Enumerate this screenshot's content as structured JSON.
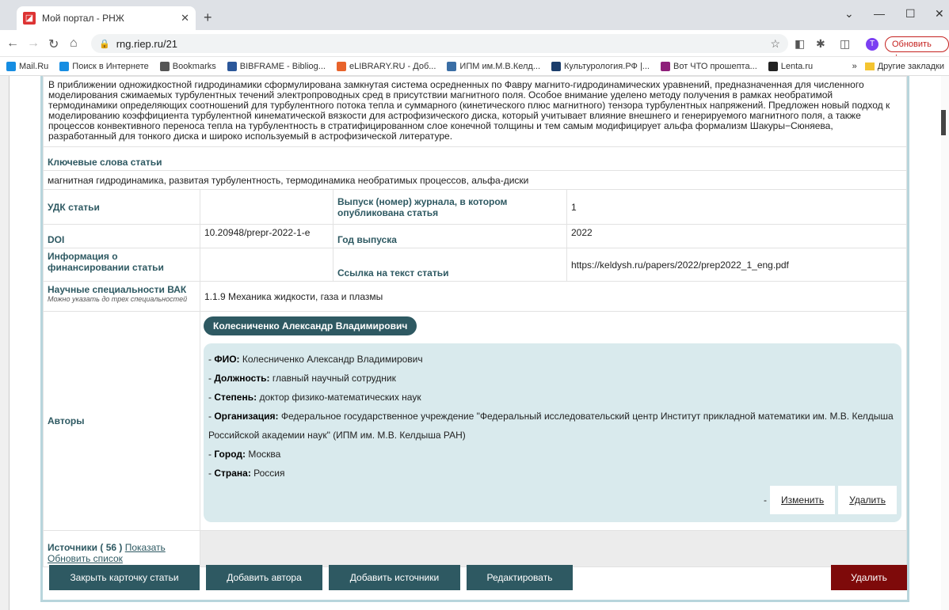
{
  "browser": {
    "tab_title": "Мой портал - РНЖ",
    "url": "rng.riep.ru/21",
    "update_label": "Обновить",
    "avatar_letter": "T",
    "bookmarks": [
      {
        "label": "Mail.Ru",
        "color": "#168de2"
      },
      {
        "label": "Поиск в Интернете",
        "color": "#168de2"
      },
      {
        "label": "Bookmarks",
        "color": "#555555"
      },
      {
        "label": "BIBFRAME - Bibliog...",
        "color": "#2b579a"
      },
      {
        "label": "eLIBRARY.RU - Доб...",
        "color": "#e8632b"
      },
      {
        "label": "ИПМ им.М.В.Келд...",
        "color": "#3a6ea5"
      },
      {
        "label": "Культурология.РФ |...",
        "color": "#1a3d6b"
      },
      {
        "label": "Вот ЧТО прошепта...",
        "color": "#8e1f7a"
      },
      {
        "label": "Lenta.ru",
        "color": "#222222"
      }
    ],
    "other_bookmarks": "Другие закладки"
  },
  "article": {
    "abstract": "В приближении одножидкостной гидродинамики сформулирована замкнутая система осредненных по Фавру магнито-гидродинамических уравнений, предназначенная для численного моделирования сжимаемых турбулентных течений электропроводных сред в присутствии магнитного поля. Особое внимание уделено методу получения в рамках необратимой термодинамики определяющих соотношений для турбулентного потока тепла и суммарного (кинетического плюс магнитного) тензора турбулентных напряжений. Предложен новый подход к моделированию коэффициента турбулентной кинематической вязкости для астрофизического диска, который учитывает влияние внешнего и генерируемого магнитного поля, а также процессов конвективного переноса тепла на турбулентность в стратифицированном слое конечной толщины и тем самым модифицирует альфа формализм Шакуры−Сюняева, разработанный для тонкого диска и широко используемый в астрофизической литературе.",
    "keywords_label": "Ключевые слова статьи",
    "keywords": "магнитная гидродинамика, развитая турбулентность, термодинамика необратимых процессов, альфа-диски",
    "udk_label": "УДК статьи",
    "udk": "",
    "issue_label": "Выпуск (номер) журнала, в котором опубликована статья",
    "issue": "1",
    "doi_label": "DOI",
    "doi": "10.20948/prepr-2022-1-e",
    "year_label": "Год выпуска",
    "year": "2022",
    "funding_label": "Информация о финансировании статьи",
    "funding": "",
    "link_label": "Ссылка на текст статьи",
    "link": "https://keldysh.ru/papers/2022/prep2022_1_eng.pdf",
    "vak_label": "Научные специальности ВАК",
    "vak_note": "Можно указать до трех специальностей",
    "vak": "1.1.9 Механика жидкости, газа и плазмы",
    "authors_label": "Авторы",
    "author": {
      "name": "Колесниченко Александр Владимирович",
      "fio_label": "ФИО:",
      "fio": "Колесниченко Александр Владимирович",
      "position_label": "Должность:",
      "position": "главный научный сотрудник",
      "degree_label": "Степень:",
      "degree": "доктор физико-математических наук",
      "org_label": "Организация:",
      "org": "Федеральное государственное учреждение \"Федеральный исследовательский центр Институт прикладной математики им. М.В. Келдыша Российской академии наук\" (ИПМ им. М.В. Келдыша РАН)",
      "city_label": "Город:",
      "city": "Москва",
      "country_label": "Страна:",
      "country": "Россия",
      "edit_label": "Изменить",
      "delete_label": "Удалить"
    },
    "sources_label": "Источники ( 56 )",
    "sources_show": "Показать",
    "sources_refresh": "Обновить список"
  },
  "actions": {
    "close": "Закрыть карточку статьи",
    "add_author": "Добавить автора",
    "add_sources": "Добавить источники",
    "edit": "Редактировать",
    "delete": "Удалить"
  }
}
